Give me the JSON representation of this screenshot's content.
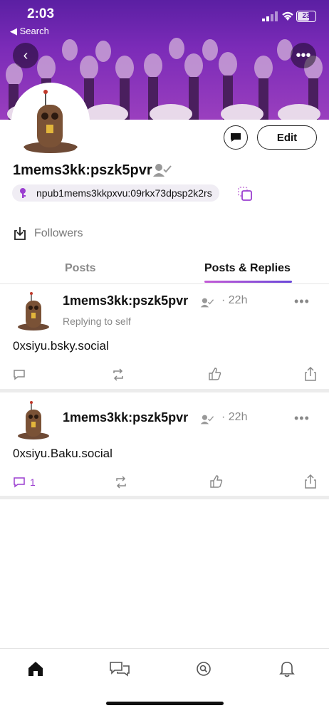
{
  "status_bar": {
    "time": "2:03",
    "back_label": "Search",
    "battery": "23"
  },
  "profile": {
    "display_name": "1mems3kk:pszk5pvr",
    "npub": "npub1mems3kkpxvu:09rkx73dpsp2k2rs",
    "edit_label": "Edit",
    "followers_label": "Followers"
  },
  "tabs": [
    {
      "label": "Posts",
      "active": false
    },
    {
      "label": "Posts & Replies",
      "active": true
    }
  ],
  "posts": [
    {
      "author": "1mems3kk:pszk5pvr",
      "time": "22h",
      "replying": "Replying to self",
      "text": "0xsiyu.bsky.social",
      "reply_count": ""
    },
    {
      "author": "1mems3kk:pszk5pvr",
      "time": "22h",
      "replying": "",
      "text": "0xsiyu.Baku.social",
      "reply_count": "1"
    }
  ],
  "nav": [
    "home-icon",
    "messages-icon",
    "search-icon",
    "notifications-icon"
  ],
  "colors": {
    "accent": "#9b3fd0",
    "banner": "#7b2bb8"
  }
}
